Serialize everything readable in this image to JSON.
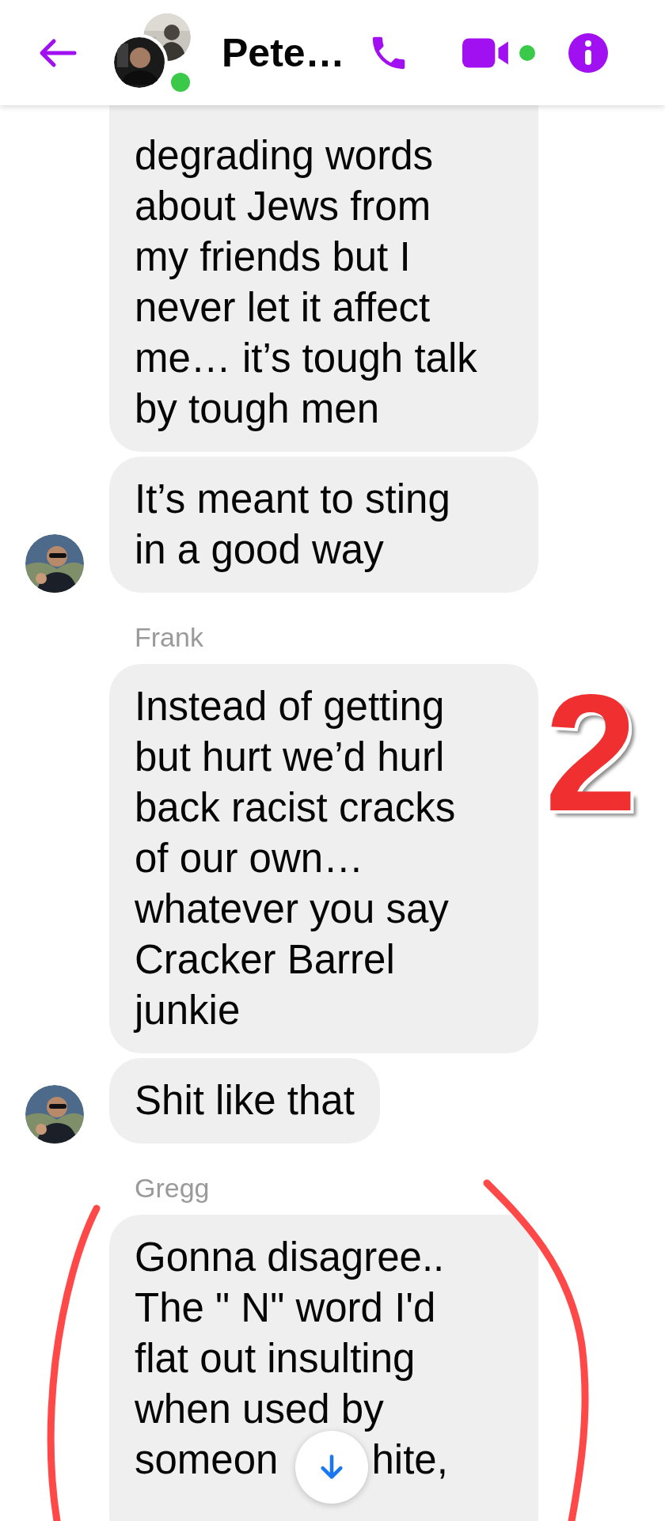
{
  "header": {
    "title": "Pete…",
    "online": true,
    "video_online": true
  },
  "messages": [
    {
      "kind": "bubble",
      "avatar": false,
      "lines": [
        "degrading words",
        "about Jews from",
        "my friends but I",
        "never let it affect",
        "me… it’s tough talk",
        "by tough men"
      ]
    },
    {
      "kind": "bubble",
      "avatar": true,
      "lines": [
        "It’s meant to sting",
        "in a good way"
      ]
    },
    {
      "kind": "sender",
      "name": "Frank"
    },
    {
      "kind": "bubble",
      "avatar": false,
      "lines": [
        "Instead of getting",
        "but hurt we’d hurl",
        "back racist cracks",
        "of our own…",
        "whatever you say",
        "Cracker Barrel",
        "junkie"
      ]
    },
    {
      "kind": "bubble",
      "avatar": true,
      "lines": [
        "Shit like that"
      ]
    },
    {
      "kind": "sender",
      "name": "Gregg"
    },
    {
      "kind": "bubble",
      "avatar": false,
      "lines": [
        "Gonna disagree..",
        "The \" N\" word I'd",
        "flat out insulting",
        "when used by"
      ],
      "split_line": [
        "someon",
        "hite,"
      ]
    }
  ],
  "annotation": {
    "text": "2"
  }
}
